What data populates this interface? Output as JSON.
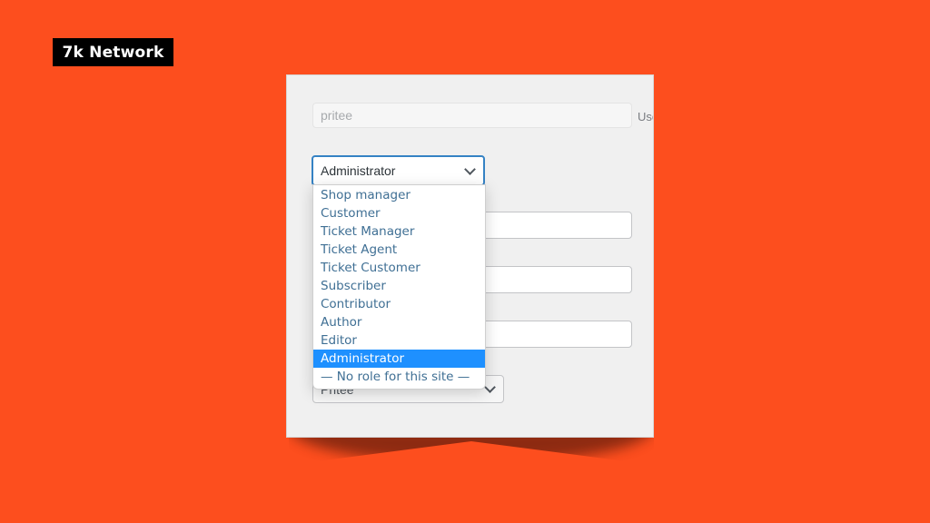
{
  "brand": {
    "label": "7k Network"
  },
  "form": {
    "username": {
      "value": "pritee",
      "hint": "Use"
    },
    "role": {
      "selected": "Administrator",
      "options": [
        "Shop manager",
        "Customer",
        "Ticket Manager",
        "Ticket Agent",
        "Ticket Customer",
        "Subscriber",
        "Contributor",
        "Author",
        "Editor",
        "Administrator",
        "— No role for this site —"
      ],
      "highlighted_index": 9
    },
    "display_name": {
      "selected": "Pritee"
    }
  },
  "colors": {
    "background": "#fd4e1e",
    "focus_border": "#3582c4",
    "highlight": "#1e90ff",
    "option_text": "#3f6f94"
  }
}
